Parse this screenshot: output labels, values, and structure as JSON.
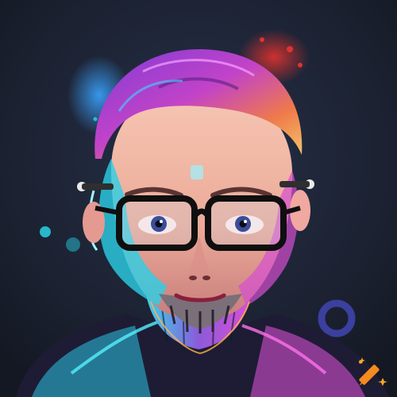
{
  "image": {
    "subject": "neon-cyberpunk-portrait",
    "palette": {
      "background": "#1a1f2b",
      "hair": "#b23dbd",
      "cyan": "#39d6e8",
      "magenta": "#e24ad6",
      "skin": "#f1b8a4",
      "glasses": "#101010",
      "orange": "#f5a623"
    },
    "icons": [
      "crayon-watermark-icon"
    ]
  }
}
